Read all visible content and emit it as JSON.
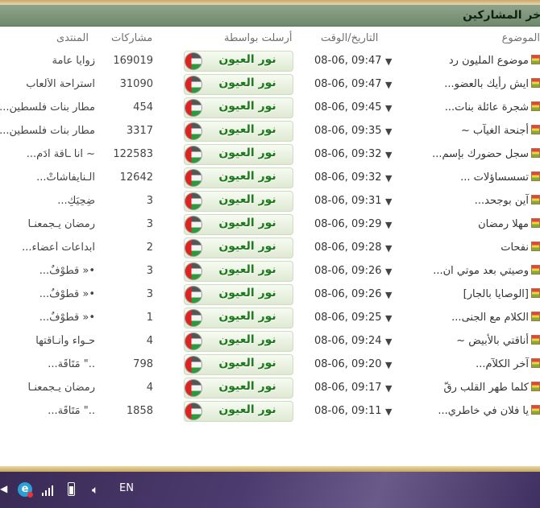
{
  "panel": {
    "title": "آخر المشاركين"
  },
  "headers": {
    "topic": "الموضوع",
    "datetime": "التاريخ/الوقت",
    "posted_by": "أرسلت بواسطة",
    "posts": "مشاركات",
    "forum": "المنتدى"
  },
  "rows": [
    {
      "topic": "موضوع المليون رد",
      "date": "08-06, 09:47",
      "poster": "نور العيون",
      "posts": "169019",
      "forum": "زوايا عامة"
    },
    {
      "topic": "ايش رأيك بالعضو...",
      "date": "08-06, 09:47",
      "poster": "نور العيون",
      "posts": "31090",
      "forum": "استراحة الألعاب"
    },
    {
      "topic": "شجرة عائلة بنات...",
      "date": "08-06, 09:45",
      "poster": "نور العيون",
      "posts": "454",
      "forum": "مطار بنات فلسطين..."
    },
    {
      "topic": "أجنحة الغيآب ~",
      "date": "08-06, 09:35",
      "poster": "نور العيون",
      "posts": "3317",
      "forum": "مطار بنات فلسطين..."
    },
    {
      "topic": "سجل حضورك بإسم...",
      "date": "08-06, 09:32",
      "poster": "نور العيون",
      "posts": "122583",
      "forum": "~ آنآ ـآقة آدَم..."
    },
    {
      "topic": "تسسساؤلات ...",
      "date": "08-06, 09:32",
      "poster": "نور العيون",
      "posts": "12642",
      "forum": "الـنآيفآشآتْ..."
    },
    {
      "topic": "آين بوجحد...",
      "date": "08-06, 09:31",
      "poster": "نور العيون",
      "posts": "3",
      "forum": "ضِحِيَكِ..."
    },
    {
      "topic": "مهلا رمضان",
      "date": "08-06, 09:29",
      "poster": "نور العيون",
      "posts": "3",
      "forum": "رمضان يـجمعنـا"
    },
    {
      "topic": "نفحات",
      "date": "08-06, 09:28",
      "poster": "نور العيون",
      "posts": "2",
      "forum": "ابداعات أعضاء..."
    },
    {
      "topic": "وصيتي بعد موتي ان...",
      "date": "08-06, 09:26",
      "poster": "نور العيون",
      "posts": "3",
      "forum": "•« قطُوْفٌ..."
    },
    {
      "topic": "[الوصايا بالجار]",
      "date": "08-06, 09:26",
      "poster": "نور العيون",
      "posts": "3",
      "forum": "•« قطُوْفٌ..."
    },
    {
      "topic": "الكلام مع الجنى...",
      "date": "08-06, 09:25",
      "poster": "نور العيون",
      "posts": "1",
      "forum": "•« قطُوْفٌ..."
    },
    {
      "topic": "أناقتي بالأبيض ~",
      "date": "08-06, 09:24",
      "poster": "نور العيون",
      "posts": "4",
      "forum": "حـواء وأنـاقتها"
    },
    {
      "topic": "آخر الكلآم...",
      "date": "08-06, 09:20",
      "poster": "نور العيون",
      "posts": "798",
      "forum": "..\" مَتَآقَة..."
    },
    {
      "topic": "كلما طهر القلب رقّ",
      "date": "08-06, 09:17",
      "poster": "نور العيون",
      "posts": "4",
      "forum": "رمضان يـجمعنـا"
    },
    {
      "topic": "يا فلان في خاطري...",
      "date": "08-06, 09:11",
      "poster": "نور العيون",
      "posts": "1858",
      "forum": "..\" مَتَآقَة..."
    }
  ],
  "taskbar": {
    "language": "EN"
  },
  "colors": {
    "header_bg": "#7a9478",
    "poster_text": "#1f7a1f",
    "footer_gold": "#c9a45a"
  },
  "icons": [
    "topic-bullet-icon",
    "expand-arrow-icon",
    "flag-avatar-icon",
    "ie-icon",
    "signal-icon",
    "battery-icon",
    "speaker-icon"
  ]
}
